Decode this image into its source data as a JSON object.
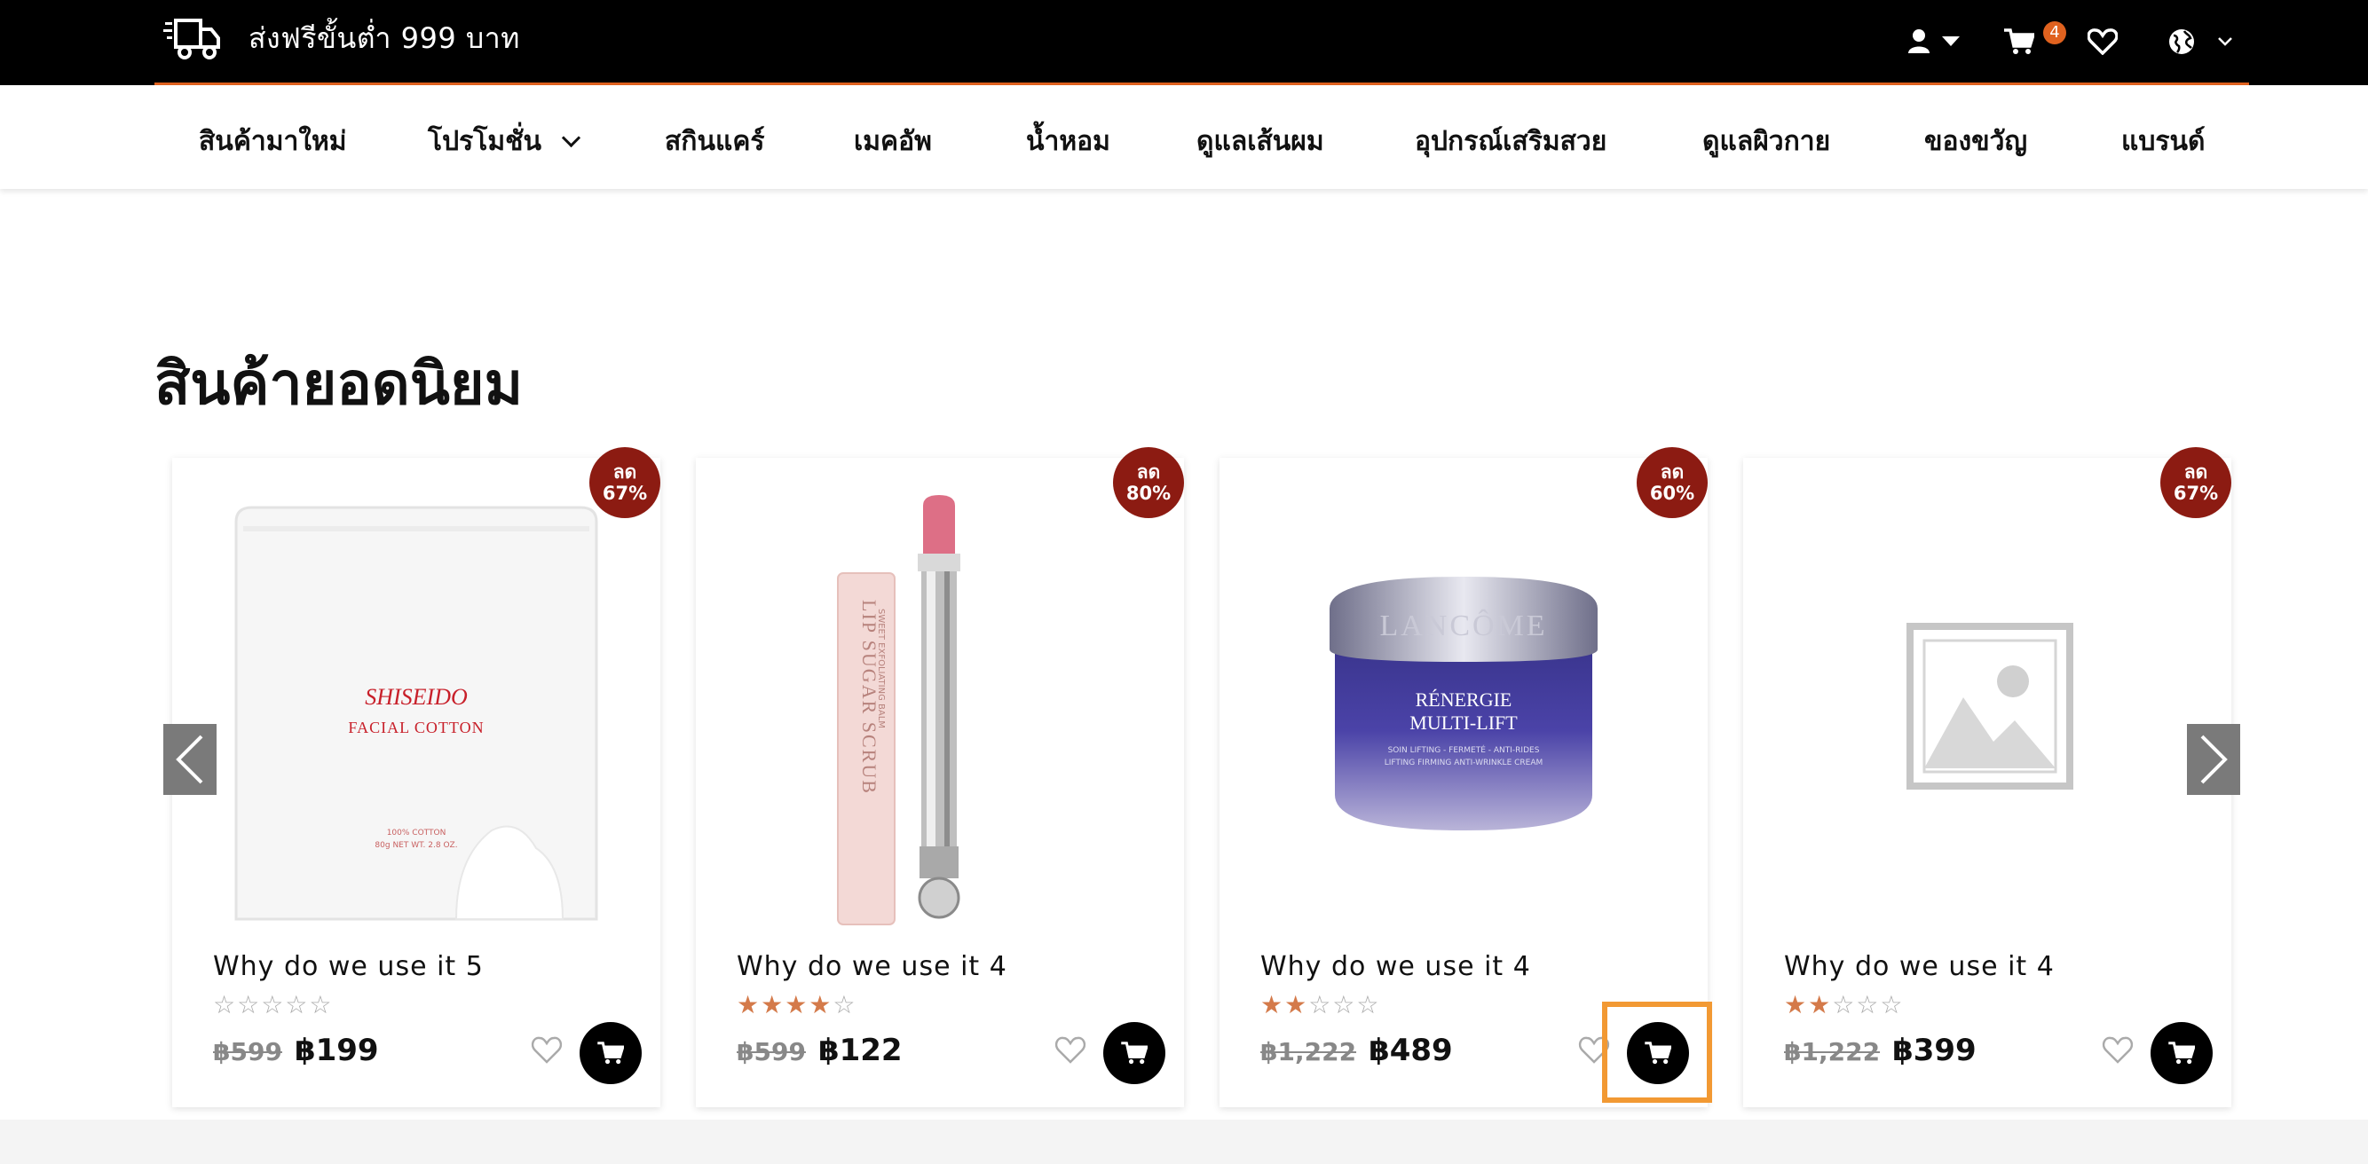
{
  "topbar": {
    "shipping_text": "ส่งฟรีขั้นต่ำ 999 บาท",
    "cart_count": "4",
    "icons": [
      "truck-icon",
      "user-icon",
      "cart-icon",
      "heart-icon",
      "globe-icon"
    ]
  },
  "nav": {
    "items": [
      {
        "label": "สินค้ามาใหม่"
      },
      {
        "label": "โปรโมชั่น"
      },
      {
        "label": "สกินแคร์"
      },
      {
        "label": "เมคอัพ"
      },
      {
        "label": "น้ำหอม"
      },
      {
        "label": "ดูแลเส้นผม"
      },
      {
        "label": "อุปกรณ์เสริมสวย"
      },
      {
        "label": "ดูแลผิวกาย"
      },
      {
        "label": "ของขวัญ"
      },
      {
        "label": "แบรนด์"
      }
    ]
  },
  "section": {
    "title": "สินค้ายอดนิยม"
  },
  "products": [
    {
      "name": "Why do we use it 5",
      "old_price": "฿599",
      "price": "฿199",
      "sale_line1": "ลด",
      "sale_line2": "67%",
      "rating": 0,
      "image": "facial-cotton-pack",
      "image_brand": "SHISEIDO",
      "image_product": "FACIAL COTTON",
      "image_detail_1": "100% COTTON",
      "image_detail_2": "80g NET WT. 2.8 OZ."
    },
    {
      "name": "Why do we use it 4",
      "old_price": "฿599",
      "price": "฿122",
      "sale_line1": "ลด",
      "sale_line2": "80%",
      "rating": 4,
      "image": "lip-sugar-scrub",
      "image_product": "LIP SUGAR SCRUB",
      "image_detail_1": "SWEET EXFOLIATING BALM"
    },
    {
      "name": "Why do we use it 4",
      "old_price": "฿1,222",
      "price": "฿489",
      "sale_line1": "ลด",
      "sale_line2": "60%",
      "rating": 2,
      "image": "renergie-cream-jar",
      "image_brand": "LANCÔME",
      "image_product_1": "RÉNERGIE",
      "image_product_2": "MULTI-LIFT",
      "image_detail_1": "SOIN LIFTING - FERMETÉ - ANTI-RIDES",
      "image_detail_2": "LIFTING FIRMING ANTI-WRINKLE CREAM"
    },
    {
      "name": "Why do we use it 4",
      "old_price": "฿1,222",
      "price": "฿399",
      "sale_line1": "ลด",
      "sale_line2": "67%",
      "rating": 2,
      "image": "placeholder-image"
    }
  ],
  "colors": {
    "accent": "#e0621f",
    "sale_badge": "#8c1b12",
    "star": "#d47a4a",
    "highlight": "#f29933"
  }
}
